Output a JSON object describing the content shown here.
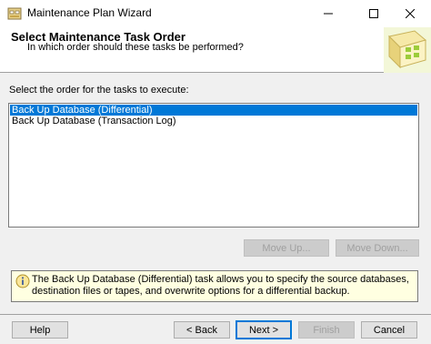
{
  "window": {
    "title": "Maintenance Plan Wizard",
    "app_icon": "maintenance-plan-icon"
  },
  "controls": {
    "minimize": "minimize-icon",
    "maximize": "maximize-icon",
    "close": "close-icon"
  },
  "header": {
    "title": "Select Maintenance Task Order",
    "subtitle": "In which order should these tasks be performed?",
    "graphic": "wizard-graphic"
  },
  "main": {
    "prompt": "Select the order for the tasks to execute:",
    "tasks": [
      {
        "label": "Back Up Database (Differential)",
        "selected": true
      },
      {
        "label": "Back Up Database (Transaction Log)",
        "selected": false
      }
    ],
    "move_up_label": "Move Up...",
    "move_down_label": "Move Down..."
  },
  "info": {
    "icon": "info-icon",
    "text": "The Back Up Database (Differential) task allows you to specify the source databases, destination files or tapes, and overwrite options for a differential backup."
  },
  "footer": {
    "help_label": "Help",
    "back_label": "< Back",
    "next_label": "Next >",
    "finish_label": "Finish",
    "cancel_label": "Cancel"
  },
  "colors": {
    "selection": "#0078d7",
    "info_background": "#ffffe1",
    "dialog_background": "#f0f0f0"
  }
}
